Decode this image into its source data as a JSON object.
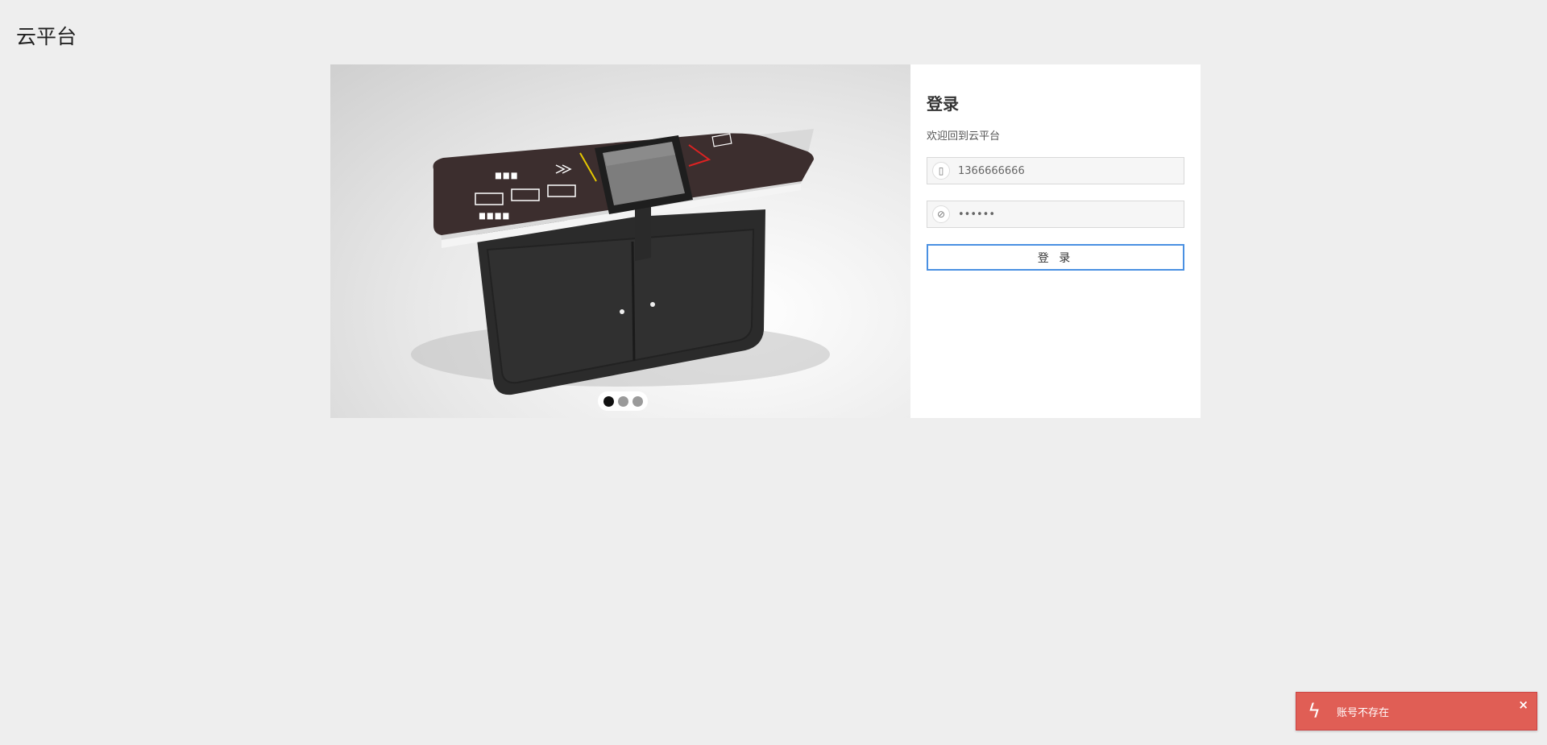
{
  "app": {
    "title": "云平台"
  },
  "login": {
    "title": "登录",
    "subtitle": "欢迎回到云平台",
    "phone_value": "1366666666",
    "password_value": "••••••",
    "submit_label": "登 录"
  },
  "carousel": {
    "slides_count": 3,
    "active_index": 0,
    "icons": [
      "phone-icon",
      "eye-off-icon"
    ]
  },
  "toast": {
    "message": "账号不存在",
    "close_label": "×",
    "icon": "lightning-icon",
    "color": "#e05e55"
  },
  "colors": {
    "background": "#eeeeee",
    "accent": "#4a90e2",
    "error": "#e05e55"
  }
}
